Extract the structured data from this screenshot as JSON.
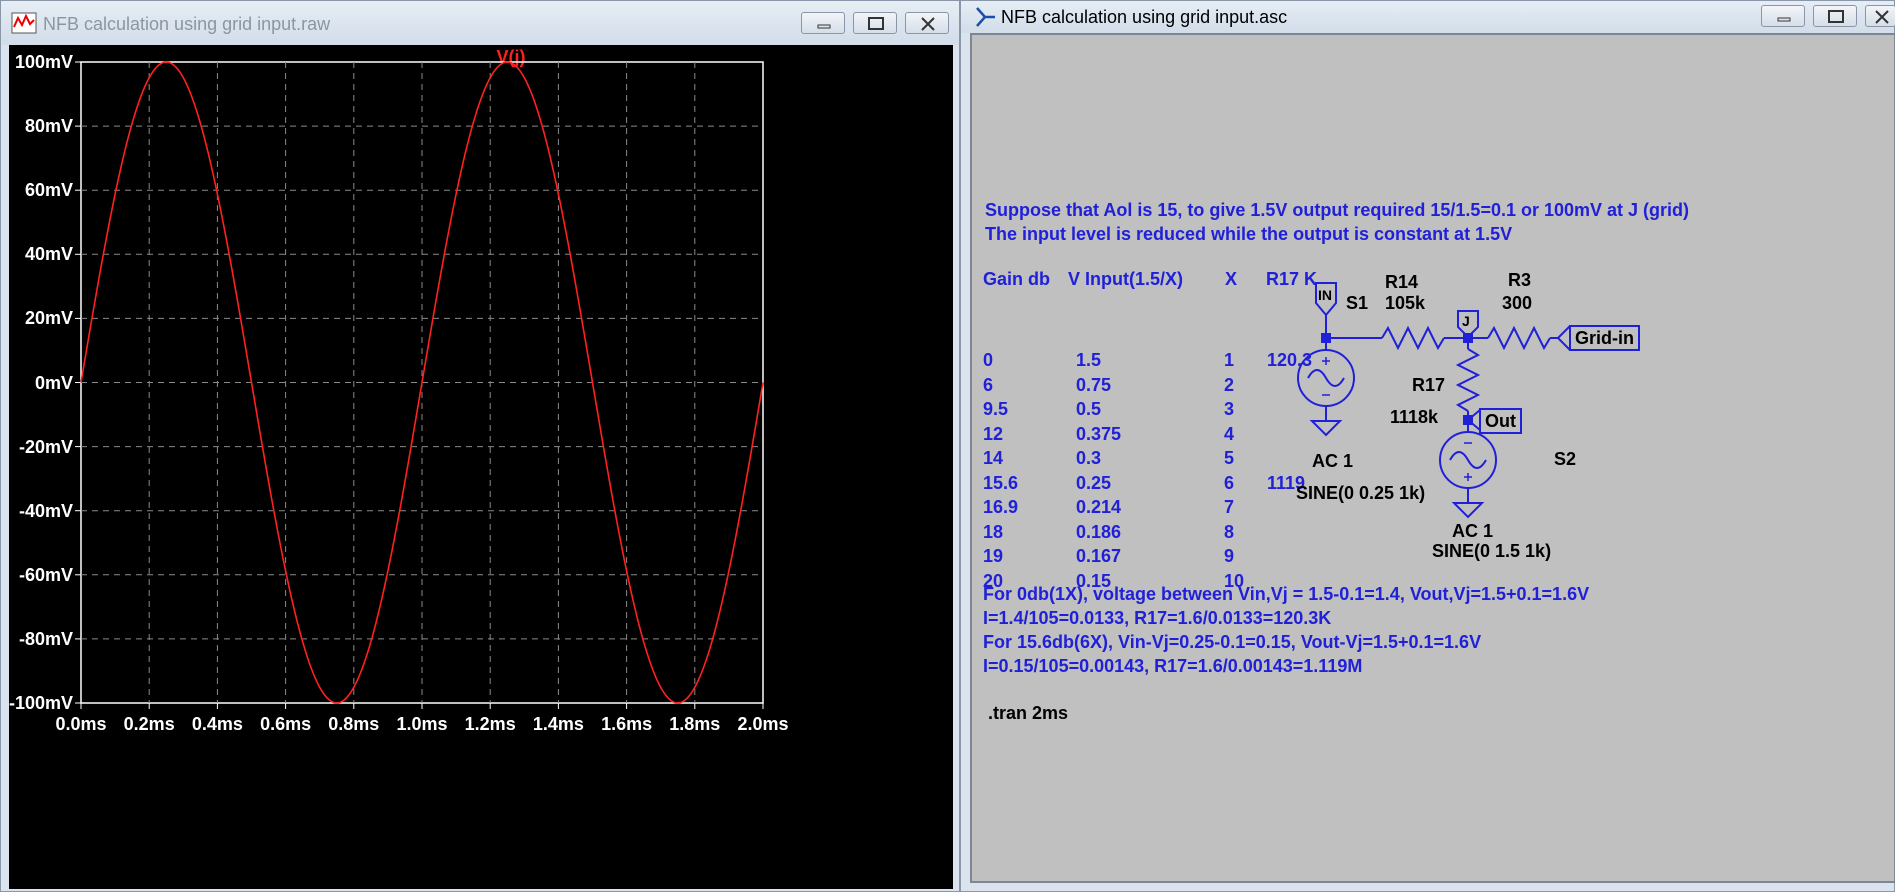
{
  "plot_window": {
    "title": "NFB calculation using grid input.raw",
    "trace_label": "V(j)"
  },
  "schematic_window": {
    "title": "NFB calculation using grid input.asc"
  },
  "chart_data": {
    "type": "line",
    "title": "",
    "xlabel": "",
    "ylabel": "",
    "x_ticks": [
      "0.0ms",
      "0.2ms",
      "0.4ms",
      "0.6ms",
      "0.8ms",
      "1.0ms",
      "1.2ms",
      "1.4ms",
      "1.6ms",
      "1.8ms",
      "2.0ms"
    ],
    "y_ticks": [
      "100mV",
      "80mV",
      "60mV",
      "40mV",
      "20mV",
      "0mV",
      "-20mV",
      "-40mV",
      "-60mV",
      "-80mV",
      "-100mV"
    ],
    "xlim": [
      0,
      2.0
    ],
    "ylim": [
      -100,
      100
    ],
    "x_unit": "ms",
    "y_unit": "mV",
    "grid": true,
    "series": [
      {
        "name": "V(j)",
        "color": "#ff2020",
        "function": "sine",
        "amplitude": 100,
        "frequency_khz": 1,
        "offset": 0,
        "x": [
          0,
          0.1,
          0.2,
          0.25,
          0.3,
          0.4,
          0.5,
          0.6,
          0.7,
          0.75,
          0.8,
          0.9,
          1.0,
          1.1,
          1.2,
          1.25,
          1.3,
          1.4,
          1.5,
          1.6,
          1.7,
          1.75,
          1.8,
          1.9,
          2.0
        ],
        "values": [
          0,
          58.8,
          95.1,
          100,
          95.1,
          58.8,
          0,
          -58.8,
          -95.1,
          -100,
          -95.1,
          -58.8,
          0,
          58.8,
          95.1,
          100,
          95.1,
          58.8,
          0,
          -58.8,
          -95.1,
          -100,
          -95.1,
          -58.8,
          0
        ]
      }
    ]
  },
  "schematic": {
    "note1": "Suppose that Aol is 15, to give 1.5V output required 15/1.5=0.1 or 100mV at J (grid)",
    "note2": "The input level is reduced while the output is constant at 1.5V",
    "table": {
      "headers": [
        "Gain db",
        "V Input(1.5/X)",
        "X",
        "R17 K"
      ],
      "gain_db": [
        "0",
        "6",
        "9.5",
        "12",
        "14",
        "15.6",
        "16.9",
        "18",
        "19",
        "20"
      ],
      "v_input": [
        "1.5",
        "0.75",
        "0.5",
        "0.375",
        "0.3",
        "0.25",
        "0.214",
        "0.186",
        "0.167",
        "0.15"
      ],
      "x": [
        "1",
        "2",
        "3",
        "4",
        "5",
        "6",
        "7",
        "8",
        "9",
        "10"
      ],
      "r17_k": [
        "120.3",
        "",
        "",
        "",
        "",
        "1119",
        "",
        "",
        "",
        ""
      ]
    },
    "calc1": "For 0db(1X), voltage between Vin,Vj = 1.5-0.1=1.4, Vout,Vj=1.5+0.1=1.6V",
    "calc2": "I=1.4/105=0.0133, R17=1.6/0.0133=120.3K",
    "calc3": "For 15.6db(6X), Vin-Vj=0.25-0.1=0.15, Vout-Vj=1.5+0.1=1.6V",
    "calc4": "I=0.15/105=0.00143, R17=1.6/0.00143=1.119M",
    "directive": ".tran 2ms",
    "components": {
      "s1_name": "S1",
      "s1_ac": "AC 1",
      "s1_sine": "SINE(0 0.25 1k)",
      "s2_name": "S2",
      "s2_ac": "AC 1",
      "s2_sine": "SINE(0 1.5 1k)",
      "r14_name": "R14",
      "r14_value": "105k",
      "r3_name": "R3",
      "r3_value": "300",
      "r17_name": "R17",
      "r17_value": "1118k",
      "net_in": "IN",
      "net_j": "J",
      "flag_grid": "Grid-in",
      "flag_out": "Out"
    }
  }
}
